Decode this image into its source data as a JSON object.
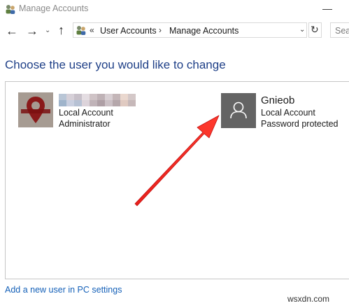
{
  "window": {
    "title": "Manage Accounts",
    "minimize_glyph": "—"
  },
  "nav": {
    "back_glyph": "←",
    "forward_glyph": "→",
    "recent_glyph": "⌄",
    "up_glyph": "↑"
  },
  "address_bar": {
    "overflow_glyph": "«",
    "breadcrumbs": [
      "User Accounts",
      "Manage Accounts"
    ],
    "separator": "›",
    "dropdown_glyph": "⌄",
    "refresh_glyph": "↻"
  },
  "search": {
    "text": "Sear"
  },
  "heading": "Choose the user you would like to change",
  "accounts": [
    {
      "name_pixelated": true,
      "type": "Local Account",
      "role": "Administrator",
      "avatar": "custom-picture"
    },
    {
      "name": "Gnieob",
      "type": "Local Account",
      "status": "Password protected",
      "avatar": "person-icon"
    }
  ],
  "add_user_link": "Add a new user in PC settings",
  "watermark": "wsxdn.com",
  "colors": {
    "heading": "#1e3f87",
    "link": "#1460b8",
    "annotation_arrow": "#e01b1b"
  }
}
